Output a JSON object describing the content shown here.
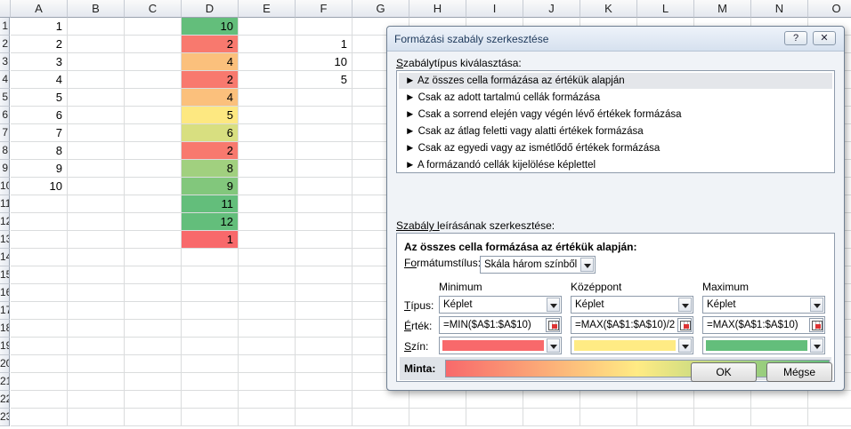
{
  "sheet": {
    "columns": [
      "A",
      "B",
      "C",
      "D",
      "E",
      "F",
      "G",
      "H",
      "I",
      "J",
      "K",
      "L",
      "M",
      "N",
      "O"
    ],
    "rows": [
      "1",
      "2",
      "3",
      "4",
      "5",
      "6",
      "7",
      "8",
      "9",
      "10",
      "11",
      "12",
      "13",
      "14",
      "15",
      "16",
      "17",
      "18",
      "19",
      "20",
      "21",
      "22",
      "23"
    ],
    "col_a": [
      "1",
      "2",
      "3",
      "4",
      "5",
      "6",
      "7",
      "8",
      "9",
      "10"
    ],
    "col_d": [
      "10",
      "2",
      "4",
      "2",
      "4",
      "5",
      "6",
      "2",
      "8",
      "9",
      "11",
      "12",
      "1"
    ],
    "col_d_colors": [
      "#63be7b",
      "#f8796e",
      "#fbc07c",
      "#f8796e",
      "#fbc07c",
      "#fde881",
      "#d8df80",
      "#f8796e",
      "#a1d07f",
      "#82c77c",
      "#63be7b",
      "#63be7b",
      "#f8696b"
    ],
    "col_f": [
      "1",
      "10",
      "5"
    ]
  },
  "dialog": {
    "title": "Formázási szabály szerkesztése",
    "help_label": "?",
    "close_label": "✕",
    "ruletype_label": "Szabálytípus kiválasztása:",
    "ruletypes": [
      "► Az összes cella formázása az értékük alapján",
      "► Csak az adott tartalmú cellák formázása",
      "► Csak a sorrend elején vagy végén lévő értékek formázása",
      "► Csak az átlag feletti vagy alatti értékek formázása",
      "► Csak az egyedi vagy az ismétlődő értékek formázása",
      "► A formázandó cellák kijelölése képlettel"
    ],
    "selected_ruletype": 0,
    "desc_label": "Szabály leírásának szerkesztése:",
    "desc_heading": "Az összes cella formázása az értékük alapján:",
    "format_style_label": "Formátumstílus:",
    "format_style_value": "Skála három színből",
    "minimum_label": "Minimum",
    "midpoint_label": "Középpont",
    "maximum_label": "Maximum",
    "type_label": "Típus:",
    "value_label": "Érték:",
    "color_label": "Szín:",
    "sample_label": "Minta:",
    "min_type": "Képlet",
    "mid_type": "Képlet",
    "max_type": "Képlet",
    "min_value": "=MIN($A$1:$A$10)",
    "mid_value": "=MAX($A$1:$A$10)/2",
    "max_value": "=MAX($A$1:$A$10)",
    "min_color": "#f8696b",
    "mid_color": "#ffeb84",
    "max_color": "#63be7b",
    "ok_label": "OK",
    "cancel_label": "Mégse"
  }
}
